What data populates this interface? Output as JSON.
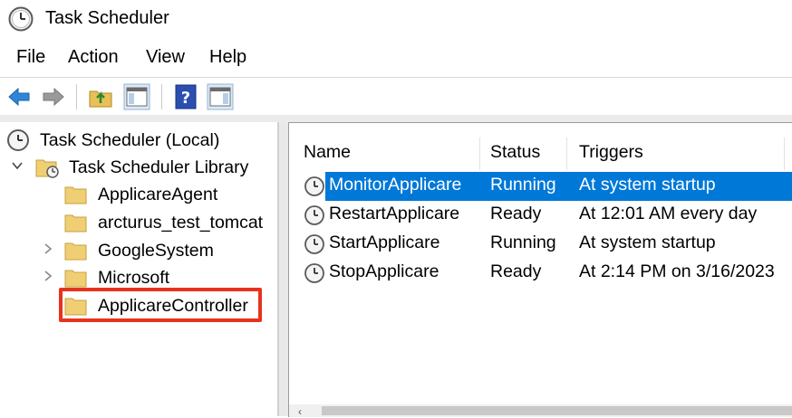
{
  "window": {
    "title": "Task Scheduler",
    "icon": "clock-icon"
  },
  "menu": [
    "File",
    "Action",
    "View",
    "Help"
  ],
  "toolbar": {
    "buttons": [
      "back-arrow-icon",
      "forward-arrow-icon",
      "up-folder-icon",
      "show-hide-console-tree-icon",
      "help-icon",
      "show-hide-action-pane-icon"
    ]
  },
  "tree": {
    "root": "Task Scheduler (Local)",
    "library": "Task Scheduler Library",
    "folders": [
      {
        "label": "ApplicareAgent",
        "expandable": false
      },
      {
        "label": "arcturus_test_tomcat",
        "expandable": false
      },
      {
        "label": "GoogleSystem",
        "expandable": true
      },
      {
        "label": "Microsoft",
        "expandable": true
      },
      {
        "label": "ApplicareController",
        "expandable": false,
        "highlighted": true
      }
    ]
  },
  "grid": {
    "columns": [
      "Name",
      "Status",
      "Triggers"
    ],
    "rows": [
      {
        "name": "MonitorApplicare",
        "status": "Running",
        "trigger": "At system startup",
        "selected": true
      },
      {
        "name": "RestartApplicare",
        "status": "Ready",
        "trigger": "At 12:01 AM every day",
        "selected": false
      },
      {
        "name": "StartApplicare",
        "status": "Running",
        "trigger": "At system startup",
        "selected": false
      },
      {
        "name": "StopApplicare",
        "status": "Ready",
        "trigger": "At 2:14 PM on 3/16/2023",
        "selected": false
      }
    ]
  },
  "colors": {
    "selection": "#0078d7",
    "highlight_box": "#e8321e"
  }
}
